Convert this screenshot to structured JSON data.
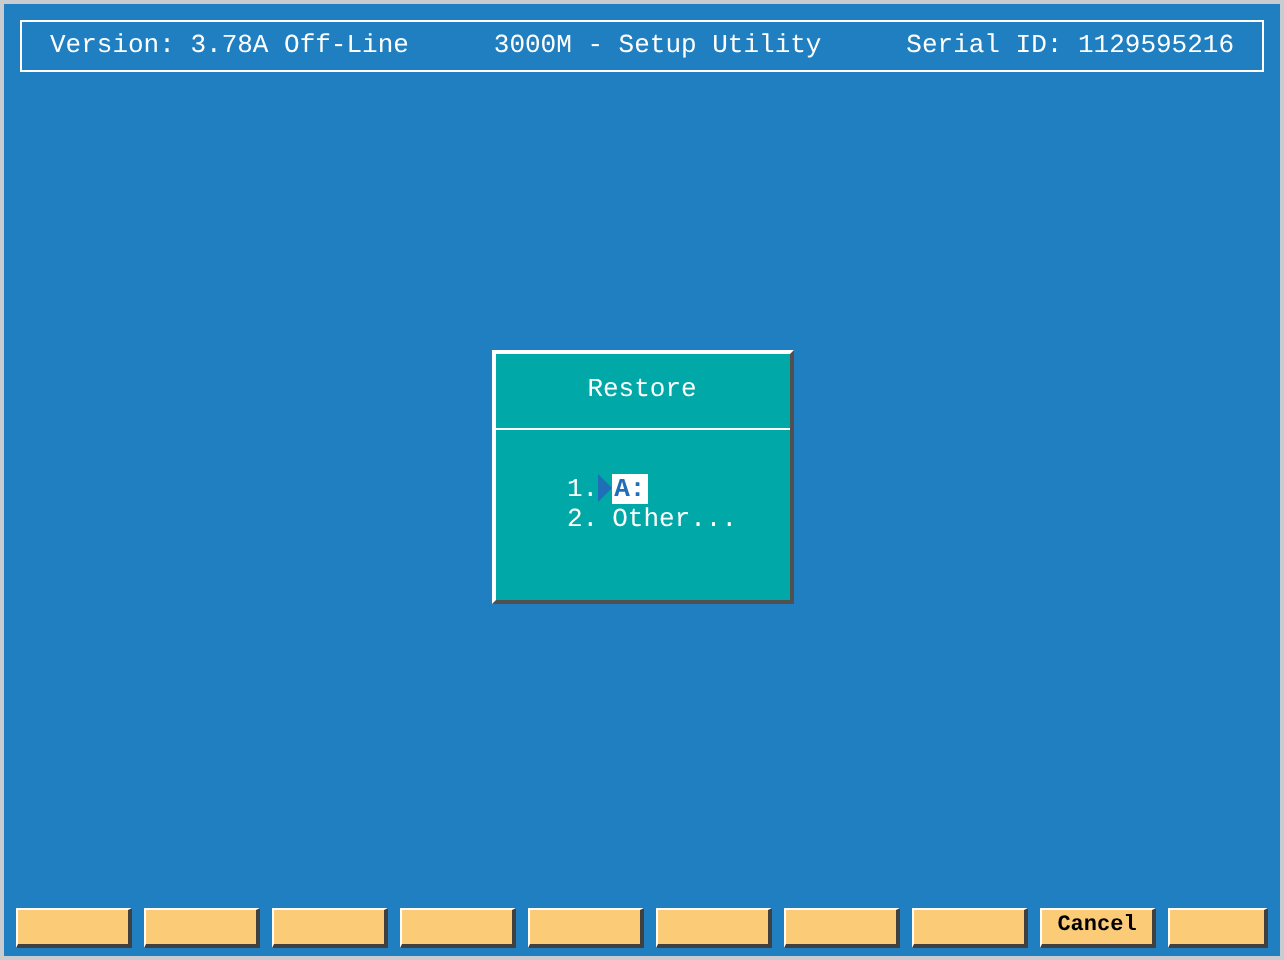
{
  "header": {
    "version": "Version: 3.78A Off-Line",
    "title": "3000M - Setup Utility",
    "serial": "Serial ID: 1129595216"
  },
  "dialog": {
    "title": "Restore",
    "items": [
      {
        "number": "1.",
        "label": "A:",
        "selected": true
      },
      {
        "number": "2.",
        "label": "Other...",
        "selected": false
      }
    ]
  },
  "function_keys": [
    {
      "kind": "blank"
    },
    {
      "kind": "blank"
    },
    {
      "kind": "blank"
    },
    {
      "kind": "blank"
    },
    {
      "kind": "blank"
    },
    {
      "kind": "blank"
    },
    {
      "kind": "blank"
    },
    {
      "kind": "blank"
    },
    {
      "kind": "labeled",
      "label": "Cancel"
    },
    {
      "kind": "blank"
    }
  ]
}
